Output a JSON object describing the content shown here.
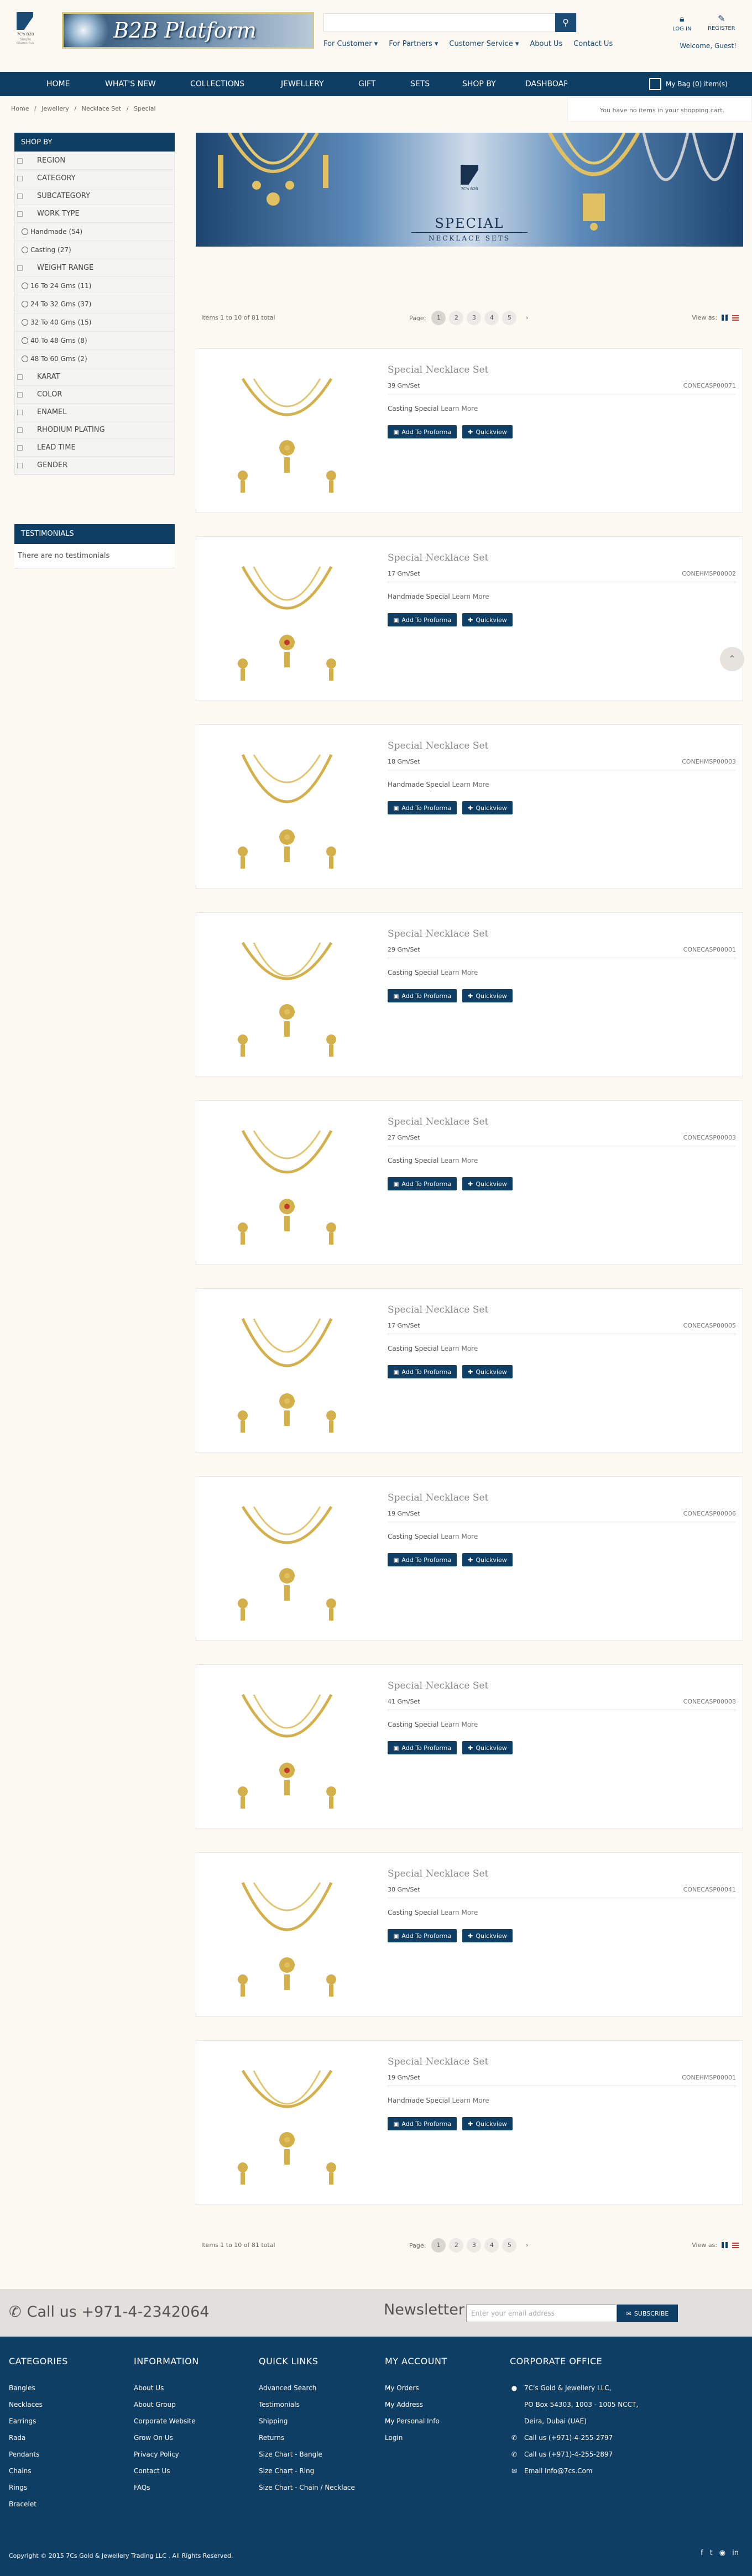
{
  "header": {
    "logo_text": "7C's B2B",
    "logo_subtext": "Simply Glamorous",
    "banner_text": "B2B Platform",
    "search_placeholder": "",
    "top_links": [
      "For Customer ▾",
      "For Partners ▾",
      "Customer Service ▾",
      "About Us",
      "Contact Us"
    ],
    "login_label": "LOG IN",
    "register_label": "REGISTER",
    "welcome_text": "Welcome, Guest!"
  },
  "nav": {
    "items": [
      "HOME",
      "WHAT'S NEW",
      "COLLECTIONS",
      "JEWELLERY",
      "GIFT",
      "SETS",
      "SHOP BY",
      "DASHBOARD"
    ],
    "bag_label": "My Bag (0) item(s)",
    "cart_message": "You have no items in your shopping cart."
  },
  "breadcrumb": [
    "Home",
    "/",
    "Jewellery",
    "/",
    "Necklace Set",
    "/",
    "Special"
  ],
  "sidebar": {
    "title": "SHOP BY",
    "filters": [
      {
        "label": "REGION",
        "options": []
      },
      {
        "label": "CATEGORY",
        "options": []
      },
      {
        "label": "SUBCATEGORY",
        "options": []
      },
      {
        "label": "WORK TYPE",
        "options": [
          "Handmade (54)",
          "Casting (27)"
        ]
      },
      {
        "label": "WEIGHT RANGE",
        "options": [
          "16 To 24 Gms (11)",
          "24 To 32 Gms (37)",
          "32 To 40 Gms (15)",
          "40 To 48 Gms (8)",
          "48 To 60 Gms (2)"
        ]
      },
      {
        "label": "KARAT",
        "options": []
      },
      {
        "label": "COLOR",
        "options": []
      },
      {
        "label": "ENAMEL",
        "options": []
      },
      {
        "label": "RHODIUM PLATING",
        "options": []
      },
      {
        "label": "LEAD TIME",
        "options": []
      },
      {
        "label": "GENDER",
        "options": []
      }
    ],
    "testimonials_title": "TESTIMONIALS",
    "testimonials_empty": "There are no testimonials"
  },
  "hero": {
    "brand": "7C's B2B",
    "title": "SPECIAL",
    "subtitle": "NECKLACE SETS"
  },
  "toolbar": {
    "count": "Items 1 to 10 of 81 total",
    "page_label": "Page:",
    "pages": [
      "1",
      "2",
      "3",
      "4",
      "5"
    ],
    "current_page": "1",
    "next": "›",
    "view_as": "View as:"
  },
  "products": [
    {
      "name": "Special Necklace Set",
      "weight": "39 Gm/Set",
      "code": "CONECASP00071",
      "type": "Casting Special",
      "learn": "Learn More"
    },
    {
      "name": "Special Necklace Set",
      "weight": "17 Gm/Set",
      "code": "CONEHMSP00002",
      "type": "Handmade Special",
      "learn": "Learn More"
    },
    {
      "name": "Special Necklace Set",
      "weight": "18 Gm/Set",
      "code": "CONEHMSP00003",
      "type": "Handmade Special",
      "learn": "Learn More"
    },
    {
      "name": "Special Necklace Set",
      "weight": "29 Gm/Set",
      "code": "CONECASP00001",
      "type": "Casting Special",
      "learn": "Learn More"
    },
    {
      "name": "Special Necklace Set",
      "weight": "27 Gm/Set",
      "code": "CONECASP00003",
      "type": "Casting Special",
      "learn": "Learn More"
    },
    {
      "name": "Special Necklace Set",
      "weight": "17 Gm/Set",
      "code": "CONECASP00005",
      "type": "Casting Special",
      "learn": "Learn More"
    },
    {
      "name": "Special Necklace Set",
      "weight": "19 Gm/Set",
      "code": "CONECASP00006",
      "type": "Casting Special",
      "learn": "Learn More"
    },
    {
      "name": "Special Necklace Set",
      "weight": "41 Gm/Set",
      "code": "CONECASP00008",
      "type": "Casting Special",
      "learn": "Learn More"
    },
    {
      "name": "Special Necklace Set",
      "weight": "30 Gm/Set",
      "code": "CONECASP00041",
      "type": "Casting Special",
      "learn": "Learn More"
    },
    {
      "name": "Special Necklace Set",
      "weight": "19 Gm/Set",
      "code": "CONEHMSP00001",
      "type": "Handmade Special",
      "learn": "Learn More"
    }
  ],
  "buttons": {
    "add": "Add To Proforma",
    "quick": "Quickview"
  },
  "newsletter": {
    "call": "Call us +971-4-2342064",
    "title": "Newsletter",
    "placeholder": "Enter your email address",
    "subscribe": "SUBSCRIBE"
  },
  "footer": {
    "categories": {
      "title": "CATEGORIES",
      "items": [
        "Bangles",
        "Necklaces",
        "Earrings",
        "Rada",
        "Pendants",
        "Chains",
        "Rings",
        "Bracelet"
      ]
    },
    "information": {
      "title": "INFORMATION",
      "items": [
        "About Us",
        "About Group",
        "Corporate Website",
        "Grow On Us",
        "Privacy Policy",
        "Contact Us",
        "FAQs"
      ]
    },
    "quick_links": {
      "title": "QUICK LINKS",
      "items": [
        "Advanced Search",
        "Testimonials",
        "Shipping",
        "Returns",
        "Size Chart - Bangle",
        "Size Chart - Ring",
        "Size Chart - Chain / Necklace"
      ]
    },
    "my_account": {
      "title": "MY ACCOUNT",
      "items": [
        "My Orders",
        "My Address",
        "My Personal Info",
        "Login"
      ]
    },
    "corporate": {
      "title": "CORPORATE OFFICE",
      "address": [
        "7C's Gold & Jewellery LLC,",
        "PO Box 54303, 1003 - 1005 NCCT,",
        "Deira, Dubai (UAE)"
      ],
      "phone1": "Call us (+971)-4-255-2797",
      "phone2": "Call us (+971)-4-255-2897",
      "email": "Email Info@7cs.Com"
    },
    "copyright": "Copyright © 2015 7Cs Gold & Jewellery Trading LLC . All Rights Reserved."
  },
  "colors": {
    "primary": "#0e3e63",
    "gold": "#d4b04a",
    "background": "#fbf9f2"
  }
}
